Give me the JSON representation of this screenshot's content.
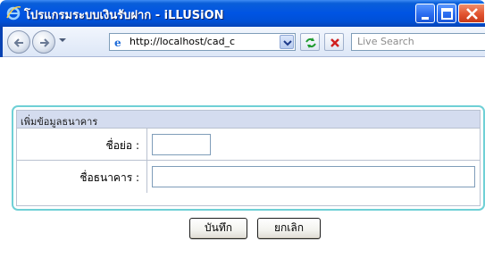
{
  "window": {
    "title": "โปรแกรมระบบเงินรับฝาก - iLLUSiON"
  },
  "toolbar": {
    "address_value": "http://localhost/cad_c",
    "search_placeholder": "Live Search"
  },
  "form": {
    "header": "เพิ่มข้อมูลธนาคาร",
    "fields": [
      {
        "label": "ชื่อย่อ :",
        "value": ""
      },
      {
        "label": "ชื่อธนาคาร :",
        "value": ""
      }
    ],
    "buttons": {
      "save": "บันทึก",
      "cancel": "ยกเลิก"
    }
  },
  "colors": {
    "titlebar": "#0054e3",
    "panel_border": "#6fd0d6",
    "panel_header": "#d4dcef"
  }
}
